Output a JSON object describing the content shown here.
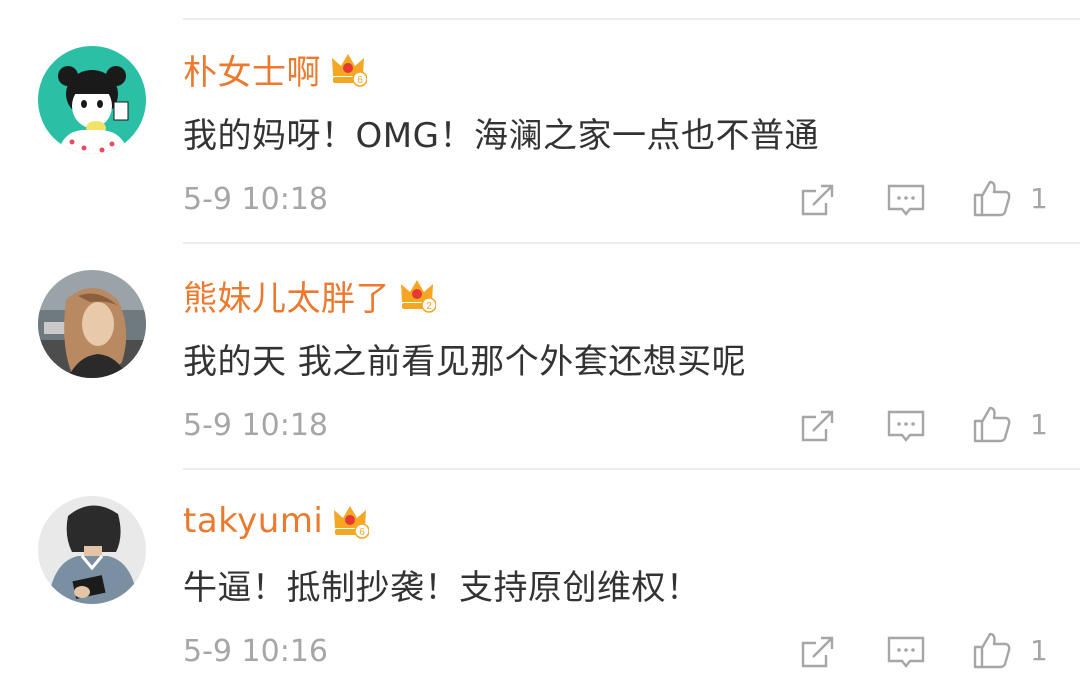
{
  "comments": [
    {
      "username": "朴女士啊",
      "crown_level": "6",
      "text": "我的妈呀！OMG！海澜之家一点也不普通",
      "time": "5-9 10:18",
      "likes": "1"
    },
    {
      "username": "熊妹儿太胖了",
      "crown_level": "2",
      "text": "我的天 我之前看见那个外套还想买呢",
      "time": "5-9 10:18",
      "likes": "1"
    },
    {
      "username": "takyumi",
      "crown_level": "6",
      "text": "牛逼！抵制抄袭！支持原创维权！",
      "time": "5-9 10:16",
      "likes": "1"
    }
  ],
  "colors": {
    "username": "#eb7a2e",
    "text": "#333333",
    "meta": "#a6a6a6",
    "crown": "#f5a623"
  },
  "icons": {
    "repost": "share-box-icon",
    "reply": "comment-bubble-icon",
    "like": "thumbs-up-icon",
    "badge": "crown-icon"
  }
}
